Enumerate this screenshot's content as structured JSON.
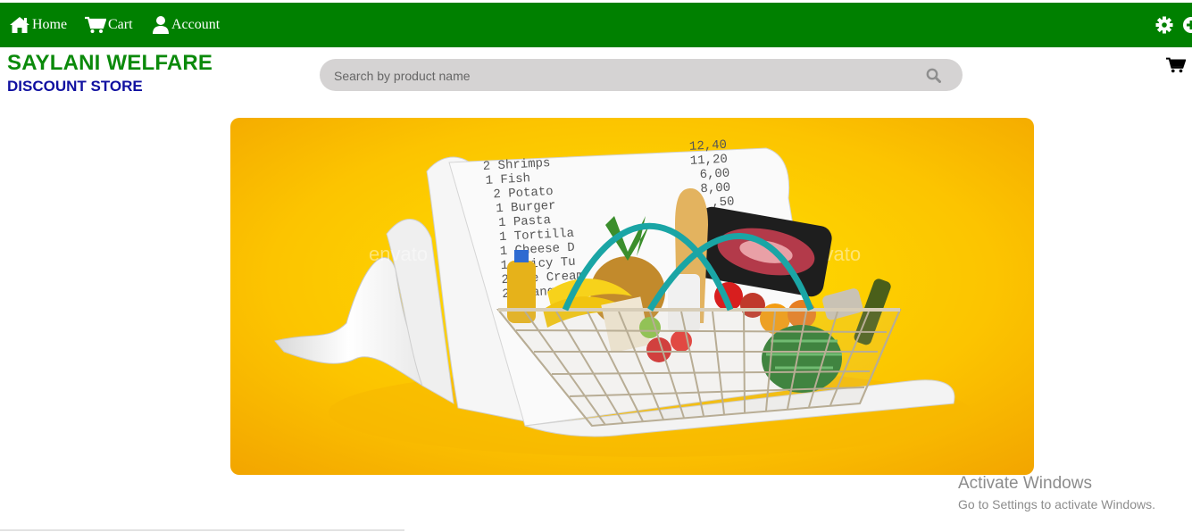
{
  "nav": {
    "home_label": "Home",
    "cart_label": "Cart",
    "account_label": "Account",
    "background": "#008000"
  },
  "brand": {
    "title": "SAYLANI WELFARE",
    "subtitle": "DISCOUNT STORE",
    "title_color": "#0b8a0b",
    "subtitle_color": "#1010a0"
  },
  "search": {
    "placeholder": "Search by product name",
    "value": ""
  },
  "banner": {
    "image": "grocery-basket-on-receipt",
    "watermark": "envato",
    "receipt_lines": [
      {
        "qty": "2",
        "name": "Shrimps",
        "price": "12,40"
      },
      {
        "qty": "1",
        "name": "Fish",
        "price": "11,20"
      },
      {
        "qty": "2",
        "name": "Potato",
        "price": "6,00"
      },
      {
        "qty": "1",
        "name": "Burger",
        "price": "8,00"
      },
      {
        "qty": "1",
        "name": "Pasta",
        "price": ",50"
      },
      {
        "qty": "1",
        "name": "Tortilla",
        "price": ""
      },
      {
        "qty": "1",
        "name": "Cheese D",
        "price": ""
      },
      {
        "qty": "1",
        "name": "Spicy Tu",
        "price": ""
      },
      {
        "qty": "2",
        "name": "Ice Cream",
        "price": ""
      },
      {
        "qty": "2",
        "name": "Orange Jui",
        "price": ""
      }
    ]
  },
  "os_watermark": {
    "title": "Activate Windows",
    "subtitle": "Go to Settings to activate Windows."
  }
}
